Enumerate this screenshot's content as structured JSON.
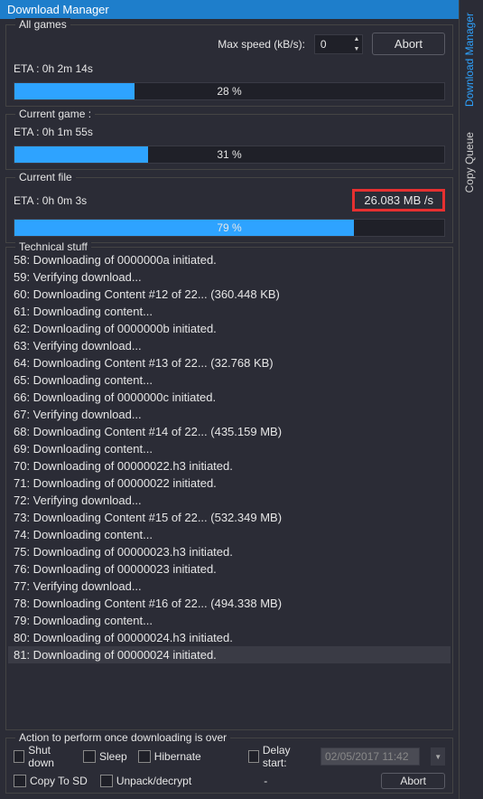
{
  "window": {
    "title": "Download Manager"
  },
  "side_tabs": {
    "download_manager": "Download Manager",
    "copy_queue": "Copy Queue"
  },
  "all_games": {
    "legend": "All games",
    "eta_label": "ETA : 0h 2m 14s",
    "max_speed_label": "Max speed (kB/s):",
    "max_speed_value": "0",
    "abort": "Abort",
    "progress_pct": "28 %",
    "progress_width": "28%"
  },
  "current_game": {
    "legend": "Current game :",
    "eta_label": "ETA : 0h 1m 55s",
    "progress_pct": "31 %",
    "progress_width": "31%"
  },
  "current_file": {
    "legend": "Current file",
    "eta_label": "ETA : 0h 0m 3s",
    "speed": "26.083 MB /s",
    "progress_pct": "79 %",
    "progress_width": "79%"
  },
  "technical": {
    "legend": "Technical stuff",
    "log": [
      "58: Downloading of 0000000a initiated.",
      "59: Verifying download...",
      "60: Downloading Content #12 of 22... (360.448 KB)",
      "61: Downloading content...",
      "62: Downloading of 0000000b initiated.",
      "63: Verifying download...",
      "64: Downloading Content #13 of 22... (32.768 KB)",
      "65: Downloading content...",
      "66: Downloading of 0000000c initiated.",
      "67: Verifying download...",
      "68: Downloading Content #14 of 22... (435.159 MB)",
      "69: Downloading content...",
      "70: Downloading of 00000022.h3 initiated.",
      "71: Downloading of 00000022 initiated.",
      "72: Verifying download...",
      "73: Downloading Content #15 of 22... (532.349 MB)",
      "74: Downloading content...",
      "75: Downloading of 00000023.h3 initiated.",
      "76: Downloading of 00000023 initiated.",
      "77: Verifying download...",
      "78: Downloading Content #16 of 22... (494.338 MB)",
      "79: Downloading content...",
      "80: Downloading of 00000024.h3 initiated.",
      "81: Downloading of 00000024 initiated."
    ],
    "selected_index": 23
  },
  "actions": {
    "legend": "Action to perform once downloading is over",
    "shutdown": "Shut down",
    "sleep": "Sleep",
    "hibernate": "Hibernate",
    "delay_start": "Delay start:",
    "delay_value": "02/05/2017 11:42",
    "copy_to_sd": "Copy To SD",
    "unpack": "Unpack/decrypt",
    "dash": "-",
    "abort": "Abort"
  }
}
